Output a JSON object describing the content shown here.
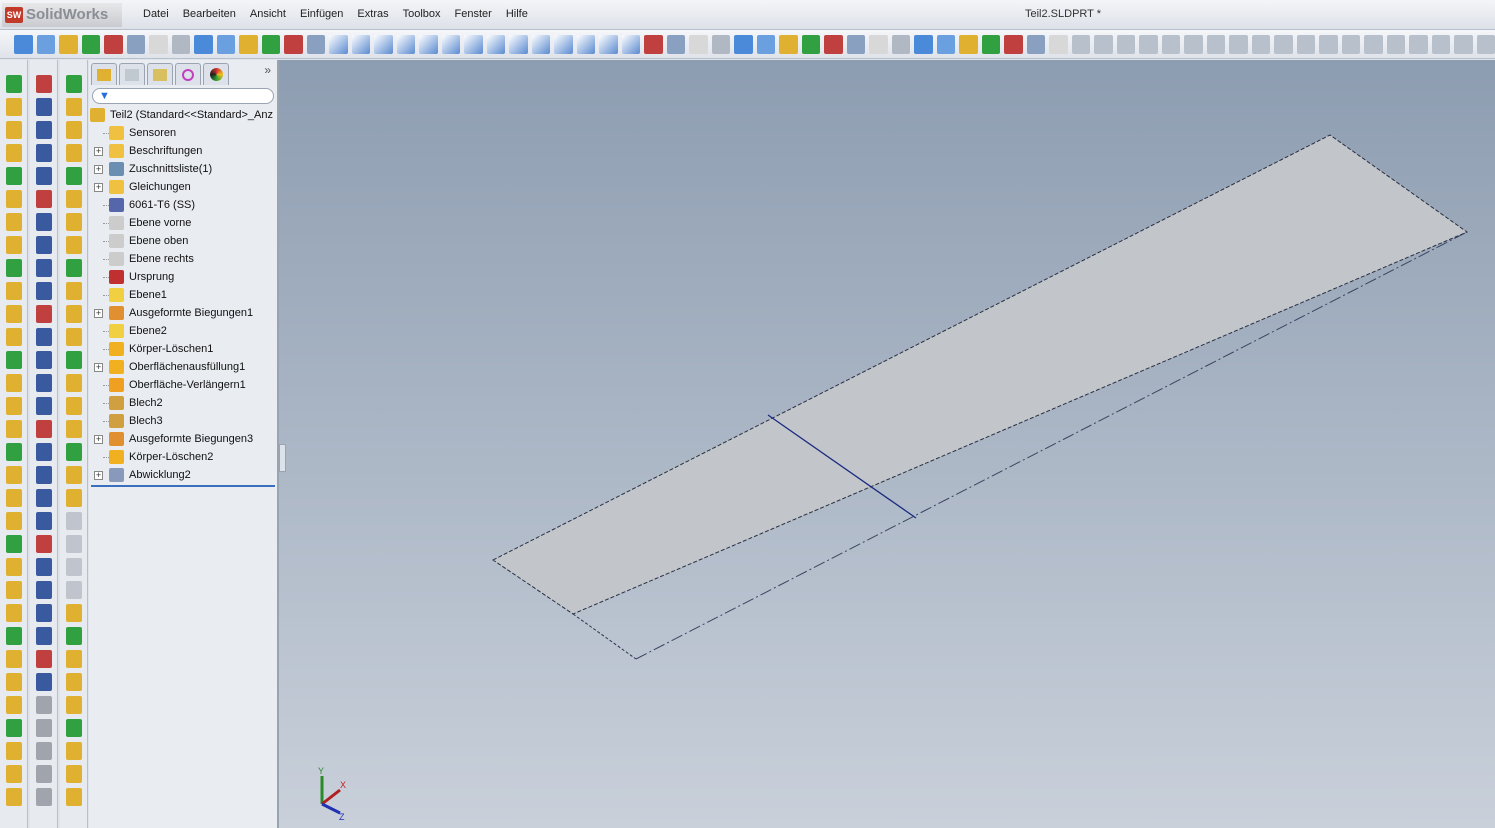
{
  "app": {
    "name": "SolidWorks",
    "logo_text": "SW",
    "document_title": "Teil2.SLDPRT *"
  },
  "menu": [
    "Datei",
    "Bearbeiten",
    "Ansicht",
    "Einfügen",
    "Extras",
    "Toolbox",
    "Fenster",
    "Hilfe"
  ],
  "tree": {
    "filter_icon": "filter-icon",
    "root": "Teil2  (Standard<<Standard>_Anz",
    "items": [
      {
        "label": "Sensoren",
        "expand": false,
        "color": "#f0c040"
      },
      {
        "label": "Beschriftungen",
        "expand": true,
        "color": "#f0c040"
      },
      {
        "label": "Zuschnittsliste(1)",
        "expand": true,
        "color": "#6a8fb0"
      },
      {
        "label": "Gleichungen",
        "expand": true,
        "color": "#f0c040"
      },
      {
        "label": "6061-T6 (SS)",
        "expand": false,
        "color": "#5566aa"
      },
      {
        "label": "Ebene vorne",
        "expand": false,
        "color": "#cccccc"
      },
      {
        "label": "Ebene oben",
        "expand": false,
        "color": "#cccccc"
      },
      {
        "label": "Ebene rechts",
        "expand": false,
        "color": "#cccccc"
      },
      {
        "label": "Ursprung",
        "expand": false,
        "color": "#c03030"
      },
      {
        "label": "Ebene1",
        "expand": false,
        "color": "#f0d040"
      },
      {
        "label": "Ausgeformte Biegungen1",
        "expand": true,
        "color": "#e09030"
      },
      {
        "label": "Ebene2",
        "expand": false,
        "color": "#f0d040"
      },
      {
        "label": "Körper-Löschen1",
        "expand": false,
        "color": "#f0b020"
      },
      {
        "label": "Oberflächenausfüllung1",
        "expand": true,
        "color": "#f0b020"
      },
      {
        "label": "Oberfläche-Verlängern1",
        "expand": false,
        "color": "#f0a020"
      },
      {
        "label": "Blech2",
        "expand": false,
        "color": "#d0a040"
      },
      {
        "label": "Blech3",
        "expand": false,
        "color": "#d0a040"
      },
      {
        "label": "Ausgeformte Biegungen3",
        "expand": true,
        "color": "#e09030"
      },
      {
        "label": "Körper-Löschen2",
        "expand": false,
        "color": "#f0b020"
      },
      {
        "label": "Abwicklung2",
        "expand": true,
        "color": "#8899bb"
      }
    ]
  },
  "triad": {
    "x": "X",
    "y": "Y",
    "z": "Z"
  },
  "colors": {
    "viewport_top": "#8d9db1",
    "viewport_bottom": "#c9d0da",
    "sheet": "#c2c6cb"
  }
}
